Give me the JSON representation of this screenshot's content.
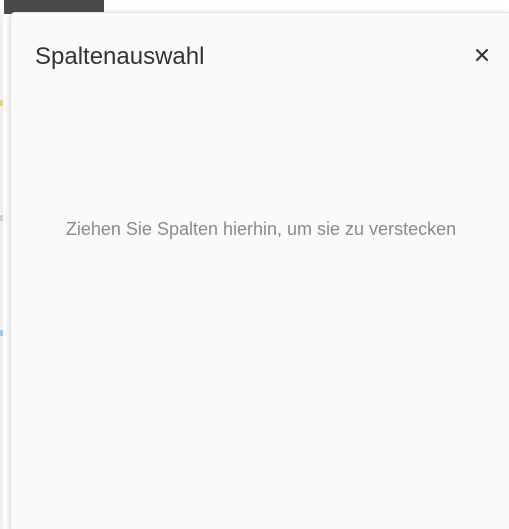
{
  "chooser": {
    "title": "Spaltenauswahl",
    "close_icon": "close-icon",
    "empty_message": "Ziehen Sie Spalten hierhin, um sie zu verstecken"
  }
}
